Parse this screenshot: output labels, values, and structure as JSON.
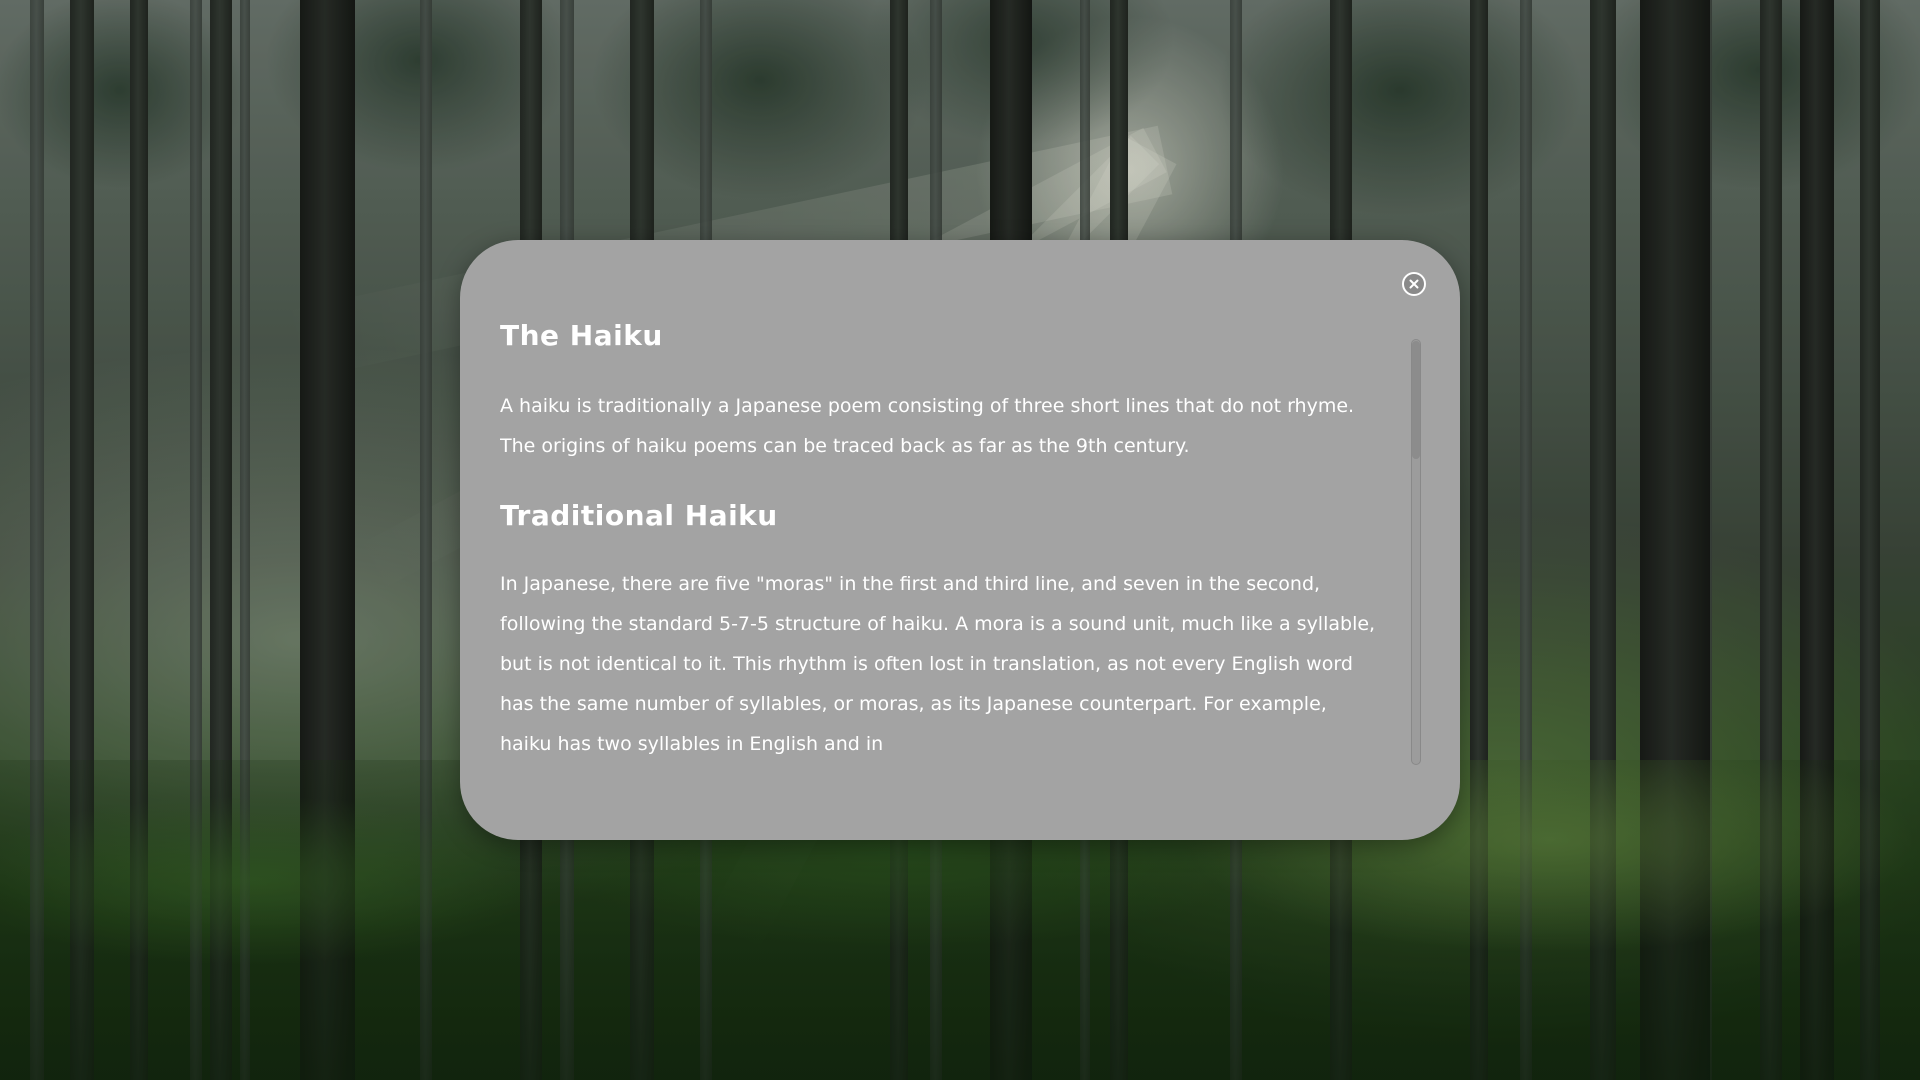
{
  "dialog": {
    "close_icon": "close-circle-icon",
    "sections": [
      {
        "heading": "The Haiku",
        "paragraph": "A haiku is traditionally a Japanese poem consisting of three short lines that do not rhyme. The origins of haiku poems can be traced back as far as the 9th century."
      },
      {
        "heading": "Traditional Haiku",
        "paragraph": "In Japanese, there are five \"moras\" in the first and third line, and seven in the second, following the standard 5-7-5 structure of haiku. A mora is a sound unit, much like a syllable, but is not identical to it. This rhythm is often lost in translation, as not every English word has the same number of syllables, or moras, as its Japanese counterpart. For example, haiku has two syllables in English and in"
      }
    ],
    "colors": {
      "panel": "#a3a3a3",
      "text": "#ffffff"
    }
  },
  "background": {
    "description_icon": "forest-background-image"
  }
}
